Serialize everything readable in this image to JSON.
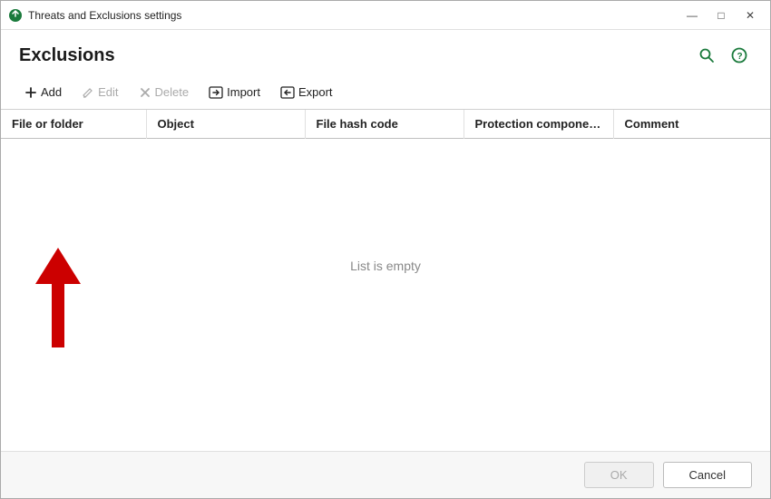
{
  "titleBar": {
    "icon": "kaspersky",
    "title": "Threats and Exclusions settings",
    "minimizeLabel": "minimize",
    "maximizeLabel": "maximize",
    "closeLabel": "close"
  },
  "pageHeader": {
    "title": "Exclusions",
    "searchIconLabel": "search",
    "helpIconLabel": "help"
  },
  "toolbar": {
    "addLabel": "Add",
    "editLabel": "Edit",
    "deleteLabel": "Delete",
    "importLabel": "Import",
    "exportLabel": "Export"
  },
  "table": {
    "columns": [
      {
        "id": "file",
        "label": "File or folder"
      },
      {
        "id": "object",
        "label": "Object"
      },
      {
        "id": "hash",
        "label": "File hash code"
      },
      {
        "id": "protection",
        "label": "Protection components"
      },
      {
        "id": "comment",
        "label": "Comment"
      }
    ],
    "emptyMessage": "List is empty"
  },
  "footer": {
    "okLabel": "OK",
    "cancelLabel": "Cancel"
  }
}
